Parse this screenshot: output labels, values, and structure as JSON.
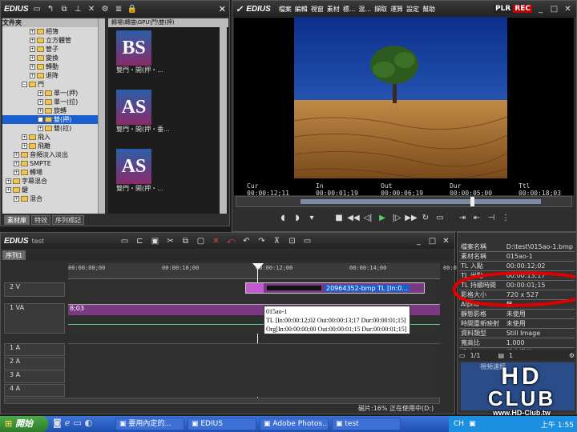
{
  "bin": {
    "app": "EDIUS",
    "tabs": [
      "素材庫",
      "特效",
      "序列標記"
    ],
    "tree": [
      {
        "label": "相簿",
        "indent": 3
      },
      {
        "label": "立方體管",
        "indent": 3
      },
      {
        "label": "管子",
        "indent": 3
      },
      {
        "label": "變換",
        "indent": 3
      },
      {
        "label": "轉動",
        "indent": 3
      },
      {
        "label": "退降",
        "indent": 3
      },
      {
        "label": "門",
        "indent": 2,
        "open": true
      },
      {
        "label": "單一(押)",
        "indent": 4
      },
      {
        "label": "單一(拉)",
        "indent": 4
      },
      {
        "label": "旋轉",
        "indent": 4
      },
      {
        "label": "雙(押)",
        "indent": 4,
        "selected": true
      },
      {
        "label": "雙(拉)",
        "indent": 4
      },
      {
        "label": "飛入",
        "indent": 2
      },
      {
        "label": "飛離",
        "indent": 2
      },
      {
        "label": "音頻淡入淡出",
        "indent": 1
      },
      {
        "label": "SMPTE",
        "indent": 1
      },
      {
        "label": "轉場",
        "indent": 1
      },
      {
        "label": "字幕混合",
        "indent": 0
      },
      {
        "label": "鍵",
        "indent": 0
      },
      {
        "label": "混合",
        "indent": 1
      }
    ],
    "tree_header": "文件夾",
    "path": "轉場\\轉描\\GPU\\門\\雙(押)",
    "thumbs": [
      {
        "letters": "BS",
        "caption": "雙門・開(押・..."
      },
      {
        "letters": "AS",
        "caption": "雙門・開(押・垂..."
      },
      {
        "letters": "AS",
        "caption": "雙門・開(押・..."
      }
    ]
  },
  "player": {
    "app": "EDIUS",
    "menu": [
      "檔案",
      "編輯",
      "視窗",
      "素材",
      "標...",
      "混...",
      "擷取",
      "運算",
      "設定",
      "幫助"
    ],
    "badges": [
      "PLR",
      "REC"
    ],
    "timecodes": {
      "cur": "00:00:12;11",
      "in": "00:00:01;19",
      "out": "00:00:06;19",
      "dur": "00:00:05;00",
      "ttl": "00:00:18;03"
    },
    "labels": {
      "cur": "Cur",
      "in": "In",
      "out": "Out",
      "dur": "Dur",
      "ttl": "Ttl"
    }
  },
  "timeline": {
    "app": "EDIUS",
    "project": "test",
    "seq_tab": "序列1",
    "ruler": [
      "00:00:08;00",
      "00:00:10;00",
      "00:00:12;00",
      "00:00:14;00",
      "00:00:16"
    ],
    "tracks": [
      "2 V",
      "1 VA",
      "1 A",
      "2 A",
      "3 A",
      "4 A"
    ],
    "clip_name": "20964352-bmp  TL [In:0...",
    "va_tc": "8;03",
    "tooltip": [
      "015ao-1",
      "TL [In:00:00:12;02 Out:00:00:13;17 Dur:00:00:01;15]",
      "Org[In:00:00:00;00 Out:00:00:01;15 Dur:00:00:01;15]"
    ],
    "status": "磁片:16% 正在使用中(D:)"
  },
  "info": {
    "rows": [
      [
        "檔案名稱",
        "D:\\test\\015ao-1.bmp"
      ],
      [
        "素材名稱",
        "015ao-1"
      ],
      [
        "TL 入點",
        "00:00:12;02"
      ],
      [
        "TL 出點",
        "00:00:13;17"
      ],
      [
        "TL 持續時間",
        "00:00:01;15"
      ],
      [
        "影格大小",
        "720 x 527"
      ],
      [
        "Alpha",
        "無"
      ],
      [
        "靜態影格",
        "未使用"
      ],
      [
        "時間重新映射",
        "未使用"
      ],
      [
        "資料類型",
        "Still Image"
      ],
      [
        "寬高比",
        "1.000"
      ],
      [
        "場序",
        "循序掃描"
      ]
    ],
    "page": "1/1",
    "page2": "1",
    "fx_item": "視頻濾鏡"
  },
  "taskbar": {
    "start": "開始",
    "tasks": [
      "要用內定的...",
      "EDIUS",
      "Adobe Photos...",
      "test"
    ],
    "lang": "CH",
    "clock": "上午 1:55"
  },
  "watermark": {
    "line1": "HD",
    "line2": "CLUB",
    "url": "www.HD-Club.tw"
  },
  "colors": {
    "accent": "#1a5fd0",
    "clip": "#7a3a82",
    "rec": "#c00000",
    "annot": "#e00000"
  }
}
